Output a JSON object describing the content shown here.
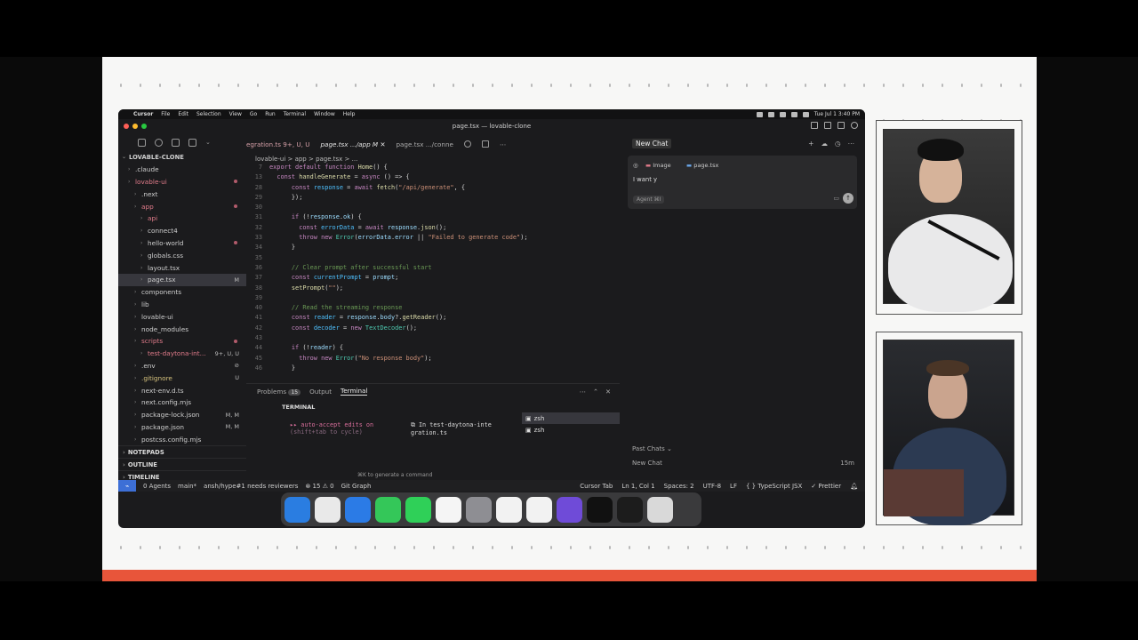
{
  "menubar": {
    "items": [
      "Cursor",
      "File",
      "Edit",
      "Selection",
      "View",
      "Go",
      "Run",
      "Terminal",
      "Window",
      "Help"
    ],
    "clock": "Tue Jul 1  3:40 PM"
  },
  "window": {
    "title": "page.tsx — lovable-clone"
  },
  "explorer": {
    "root": "LOVABLE-CLONE",
    "rows": [
      {
        "label": ".claude",
        "indent": 1
      },
      {
        "label": "lovable-ui",
        "indent": 1,
        "color": "red",
        "dot": true
      },
      {
        "label": ".next",
        "indent": 2
      },
      {
        "label": "app",
        "indent": 2,
        "color": "red",
        "dot": true
      },
      {
        "label": "api",
        "indent": 3,
        "color": "red"
      },
      {
        "label": "connect4",
        "indent": 3
      },
      {
        "label": "hello-world",
        "indent": 3,
        "dot": true
      },
      {
        "label": "globals.css",
        "indent": 3
      },
      {
        "label": "layout.tsx",
        "indent": 3
      },
      {
        "label": "page.tsx",
        "indent": 3,
        "status": "M",
        "selected": true
      },
      {
        "label": "components",
        "indent": 2
      },
      {
        "label": "lib",
        "indent": 2
      },
      {
        "label": "lovable-ui",
        "indent": 2
      },
      {
        "label": "node_modules",
        "indent": 2
      },
      {
        "label": "scripts",
        "indent": 2,
        "color": "red",
        "dot": true
      },
      {
        "label": "test-daytona-int...",
        "indent": 3,
        "status": "9+, U, U",
        "color": "red"
      },
      {
        "label": ".env",
        "indent": 2,
        "status": "⊘"
      },
      {
        "label": ".gitignore",
        "indent": 2,
        "status": "U",
        "color": "yel"
      },
      {
        "label": "next-env.d.ts",
        "indent": 2
      },
      {
        "label": "next.config.mjs",
        "indent": 2
      },
      {
        "label": "package-lock.json",
        "indent": 2,
        "status": "M, M"
      },
      {
        "label": "package.json",
        "indent": 2,
        "status": "M, M"
      },
      {
        "label": "postcss.config.mjs",
        "indent": 2
      }
    ],
    "sections": [
      "NOTEPADS",
      "OUTLINE",
      "TIMELINE"
    ]
  },
  "tabs": {
    "items": [
      "egration.ts  9+, U, U",
      "page.tsx  .../app  M",
      "page.tsx  .../conne"
    ],
    "active_index": 1
  },
  "breadcrumb": "lovable-ui  >  app  >  page.tsx  >  ...",
  "code": [
    {
      "n": "7",
      "html": "<span class='kw'>export default function</span> <span class='fn'>Home</span>() {"
    },
    {
      "n": "13",
      "html": "  <span class='kw'>const</span> <span class='fn'>handleGenerate</span> = <span class='kw'>async</span> () => {"
    },
    {
      "n": "28",
      "html": "      <span class='kw'>const</span> <span class='cst'>response</span> = <span class='kw'>await</span> <span class='fn'>fetch</span>(<span class='str'>\"/api/generate\"</span>, {"
    },
    {
      "n": "29",
      "html": "      });"
    },
    {
      "n": "30",
      "html": ""
    },
    {
      "n": "31",
      "html": "      <span class='kw'>if</span> (!<span class='var'>response</span>.<span class='var'>ok</span>) {"
    },
    {
      "n": "32",
      "html": "        <span class='kw'>const</span> <span class='cst'>errorData</span> = <span class='kw'>await</span> <span class='var'>response</span>.<span class='fn'>json</span>();"
    },
    {
      "n": "33",
      "html": "        <span class='kw'>throw new</span> <span class='typ'>Error</span>(<span class='var'>errorData</span>.<span class='var'>error</span> || <span class='str'>\"Failed to generate code\"</span>);"
    },
    {
      "n": "34",
      "html": "      }"
    },
    {
      "n": "35",
      "html": ""
    },
    {
      "n": "36",
      "html": "      <span class='cmt'>// Clear prompt after successful start</span>"
    },
    {
      "n": "37",
      "html": "      <span class='kw'>const</span> <span class='cst'>currentPrompt</span> = <span class='var'>prompt</span>;"
    },
    {
      "n": "38",
      "html": "      <span class='fn'>setPrompt</span>(<span class='str'>\"\"</span>);"
    },
    {
      "n": "39",
      "html": ""
    },
    {
      "n": "40",
      "html": "      <span class='cmt'>// Read the streaming response</span>"
    },
    {
      "n": "41",
      "html": "      <span class='kw'>const</span> <span class='cst'>reader</span> = <span class='var'>response</span>.<span class='var'>body</span>?.<span class='fn'>getReader</span>();"
    },
    {
      "n": "42",
      "html": "      <span class='kw'>const</span> <span class='cst'>decoder</span> = <span class='kw'>new</span> <span class='typ'>TextDecoder</span>();"
    },
    {
      "n": "43",
      "html": ""
    },
    {
      "n": "44",
      "html": "      <span class='kw'>if</span> (!<span class='var'>reader</span>) {"
    },
    {
      "n": "45",
      "html": "        <span class='kw'>throw new</span> <span class='typ'>Error</span>(<span class='str'>\"No response body\"</span>);"
    },
    {
      "n": "46",
      "html": "      }"
    }
  ],
  "panel": {
    "tabs": [
      "Problems",
      "Output",
      "Terminal"
    ],
    "problems_count": "15",
    "active": "Terminal",
    "section": "TERMINAL",
    "term_line1": "▸▸ auto-accept edits on",
    "term_line2": "(shift+tab to cycle)",
    "term_right": "⧉ In test-daytona-inte gration.ts",
    "hint": "⌘K to generate a command",
    "shells": [
      "zsh",
      "zsh"
    ]
  },
  "chat": {
    "title": "New Chat",
    "chip_image": "Image",
    "chip_file": "page.tsx",
    "input": "I want y",
    "agent": "Agent ⌘I",
    "past_chats": "Past Chats  ⌄",
    "new_chat": "New Chat",
    "age": "15m"
  },
  "status": {
    "agents": "0 Agents",
    "branch": "main*",
    "pr": "ansh/hype#1 needs reviewers",
    "errors": "⊗ 15  ⚠ 0",
    "git": "Git Graph",
    "cursor_tab": "Cursor Tab",
    "position": "Ln 1, Col 1",
    "spaces": "Spaces: 2",
    "encoding": "UTF-8",
    "eol": "LF",
    "lang": "{ } TypeScript JSX",
    "prettier": "✓ Prettier"
  },
  "dock_colors": [
    "#2a7de1",
    "#e9e9e9",
    "#2b7be6",
    "#34c759",
    "#2fd058",
    "#f5f5f5",
    "#8e8e93",
    "#f2f2f2",
    "#f2f2f2",
    "#6f4bd8",
    "#111111",
    "#1c1c1c",
    "#d9d9d9"
  ]
}
